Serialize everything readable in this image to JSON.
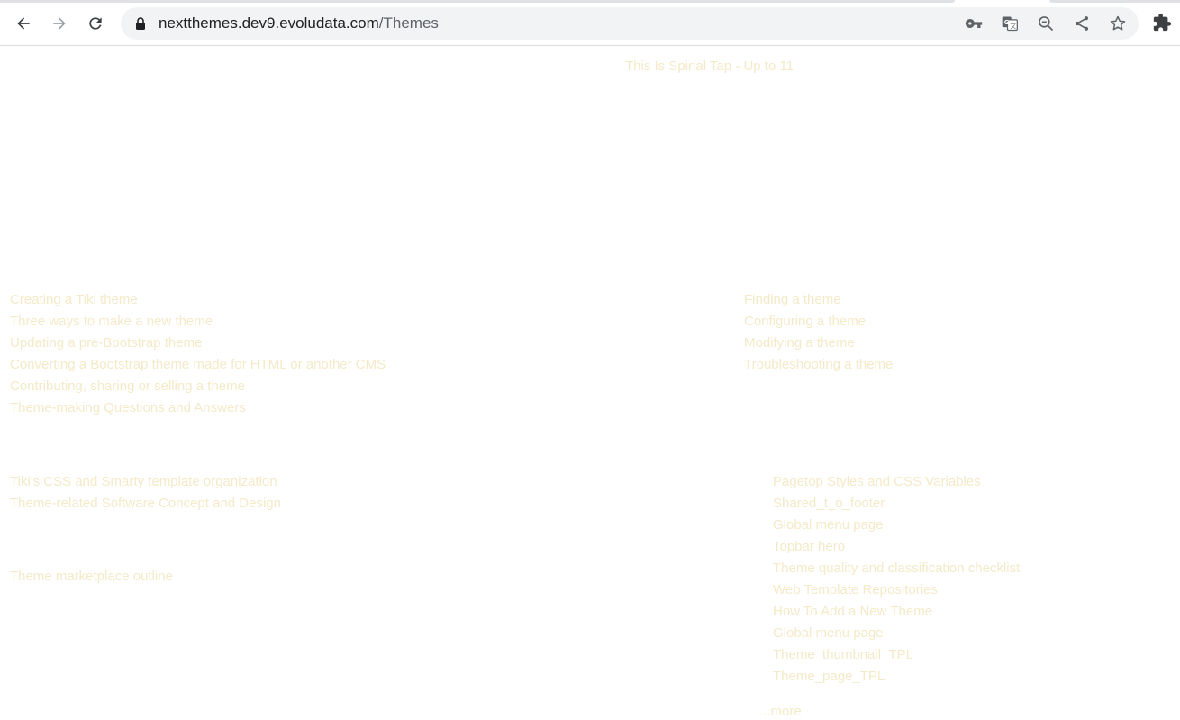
{
  "browser": {
    "url_host": "nextthemes.dev9.evoludata.com",
    "url_path": "/Themes",
    "icons": [
      "back-arrow-icon",
      "forward-arrow-icon",
      "reload-icon",
      "lock-icon",
      "key-icon",
      "translate-icon",
      "zoom-out-icon",
      "share-icon",
      "star-icon",
      "extensions-icon"
    ]
  },
  "page": {
    "tagline": "This Is Spinal Tap - Up to 11",
    "left_links_1": [
      "Creating a Tiki theme",
      "Three ways to make a new theme",
      "Updating a pre-Bootstrap theme",
      "Converting a Bootstrap theme made for HTML or another CMS",
      "Contributing, sharing or selling a theme",
      "Theme-making Questions and Answers"
    ],
    "right_links_1": [
      "Finding a theme",
      "Configuring a theme",
      "Modifying a theme",
      "Troubleshooting a theme"
    ],
    "left_links_2": [
      "Tiki's CSS and Smarty template organization",
      "Theme-related Software Concept and Design"
    ],
    "left_links_3": [
      "Theme marketplace outline"
    ],
    "right_links_2": [
      "Pagetop Styles and CSS Variables",
      "Shared_t_o_footer",
      "Global menu page",
      "Topbar hero",
      "Theme quality and classification checklist",
      "Web Template Repositories",
      "How To Add a New Theme",
      "Global menu page",
      "Theme_thumbnail_TPL",
      "Theme_page_TPL"
    ],
    "more_link": "...more"
  },
  "colors": {
    "link_text": "#f4eac8",
    "omnibox_bg": "#f1f3f4",
    "icon": "#5f6368"
  }
}
